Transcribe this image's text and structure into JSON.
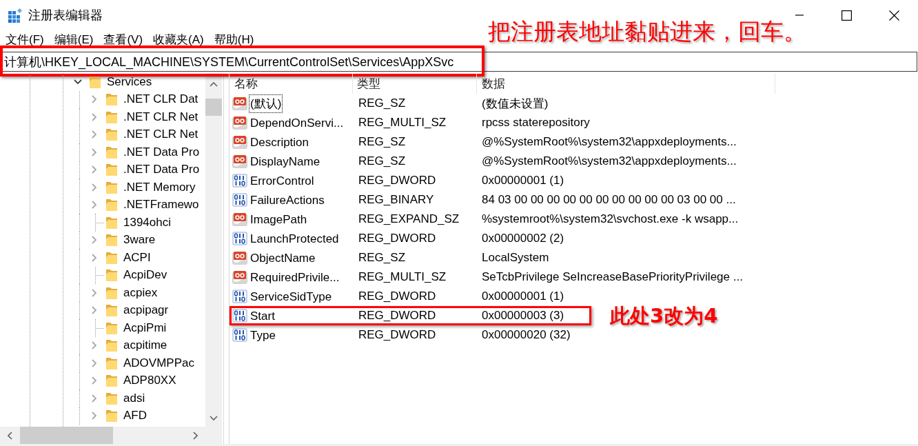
{
  "window": {
    "title": "注册表编辑器"
  },
  "menu": [
    "文件(F)",
    "编辑(E)",
    "查看(V)",
    "收藏夹(A)",
    "帮助(H)"
  ],
  "address_bar": {
    "value": "计算机\\HKEY_LOCAL_MACHINE\\SYSTEM\\CurrentControlSet\\Services\\AppXSvc",
    "highlighted": true,
    "note": "把注册表地址黏贴进来，回车。"
  },
  "tree": {
    "items": [
      {
        "label": "Services",
        "expanded": true,
        "children": [
          {
            "label": ".NET CLR Dat",
            "expandable": true
          },
          {
            "label": ".NET CLR Net",
            "expandable": true
          },
          {
            "label": ".NET CLR Net",
            "expandable": true
          },
          {
            "label": ".NET Data Pro",
            "expandable": true
          },
          {
            "label": ".NET Data Pro",
            "expandable": true
          },
          {
            "label": ".NET Memory",
            "expandable": true
          },
          {
            "label": ".NETFramewo",
            "expandable": true
          },
          {
            "label": "1394ohci",
            "expandable": false
          },
          {
            "label": "3ware",
            "expandable": true
          },
          {
            "label": "ACPI",
            "expandable": true
          },
          {
            "label": "AcpiDev",
            "expandable": false
          },
          {
            "label": "acpiex",
            "expandable": true
          },
          {
            "label": "acpipagr",
            "expandable": true
          },
          {
            "label": "AcpiPmi",
            "expandable": false
          },
          {
            "label": "acpitime",
            "expandable": true
          },
          {
            "label": "ADOVMPPac",
            "expandable": true
          },
          {
            "label": "ADP80XX",
            "expandable": true
          },
          {
            "label": "adsi",
            "expandable": true
          },
          {
            "label": "AFD",
            "expandable": true
          }
        ]
      }
    ]
  },
  "values": {
    "columns": [
      "名称",
      "类型",
      "数据"
    ],
    "rows": [
      {
        "kind": "string",
        "name": "(默认)",
        "type": "REG_SZ",
        "data": "(数值未设置)",
        "focused": true,
        "highlighted": false
      },
      {
        "kind": "string",
        "name": "DependOnServi...",
        "type": "REG_MULTI_SZ",
        "data": "rpcss staterepository",
        "focused": false,
        "highlighted": false
      },
      {
        "kind": "string",
        "name": "Description",
        "type": "REG_SZ",
        "data": "@%SystemRoot%\\system32\\appxdeployments...",
        "focused": false,
        "highlighted": false
      },
      {
        "kind": "string",
        "name": "DisplayName",
        "type": "REG_SZ",
        "data": "@%SystemRoot%\\system32\\appxdeployments...",
        "focused": false,
        "highlighted": false
      },
      {
        "kind": "binary",
        "name": "ErrorControl",
        "type": "REG_DWORD",
        "data": "0x00000001 (1)",
        "focused": false,
        "highlighted": false
      },
      {
        "kind": "binary",
        "name": "FailureActions",
        "type": "REG_BINARY",
        "data": "84 03 00 00 00 00 00 00 00 00 00 00 03 00 00 ...",
        "focused": false,
        "highlighted": false
      },
      {
        "kind": "string",
        "name": "ImagePath",
        "type": "REG_EXPAND_SZ",
        "data": "%systemroot%\\system32\\svchost.exe -k wsapp...",
        "focused": false,
        "highlighted": false
      },
      {
        "kind": "binary",
        "name": "LaunchProtected",
        "type": "REG_DWORD",
        "data": "0x00000002 (2)",
        "focused": false,
        "highlighted": false
      },
      {
        "kind": "string",
        "name": "ObjectName",
        "type": "REG_SZ",
        "data": "LocalSystem",
        "focused": false,
        "highlighted": false
      },
      {
        "kind": "string",
        "name": "RequiredPrivile...",
        "type": "REG_MULTI_SZ",
        "data": "SeTcbPrivilege SeIncreaseBasePriorityPrivilege ...",
        "focused": false,
        "highlighted": false
      },
      {
        "kind": "binary",
        "name": "ServiceSidType",
        "type": "REG_DWORD",
        "data": "0x00000001 (1)",
        "focused": false,
        "highlighted": false
      },
      {
        "kind": "binary",
        "name": "Start",
        "type": "REG_DWORD",
        "data": "0x00000003 (3)",
        "focused": false,
        "highlighted": true,
        "note": "此处3改为4"
      },
      {
        "kind": "binary",
        "name": "Type",
        "type": "REG_DWORD",
        "data": "0x00000020 (32)",
        "focused": false,
        "highlighted": false
      }
    ]
  }
}
